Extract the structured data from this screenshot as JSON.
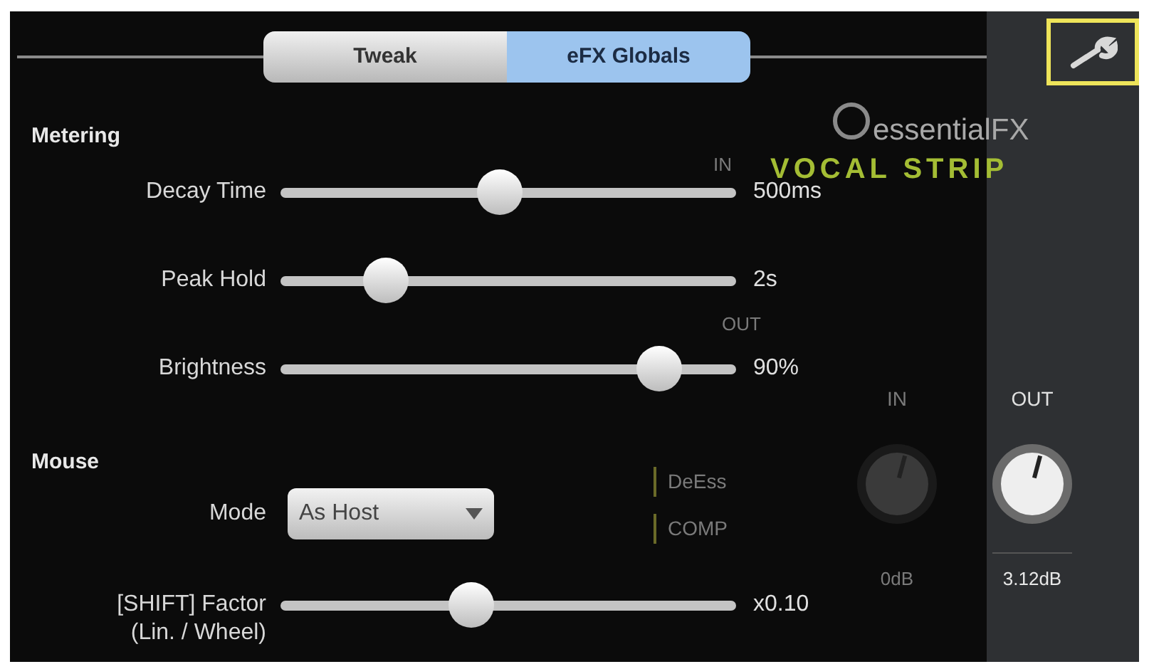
{
  "tabs": [
    {
      "label": "Tweak",
      "selected": false
    },
    {
      "label": "eFX Globals",
      "selected": true
    }
  ],
  "sections": [
    {
      "heading": "Metering",
      "rows": [
        {
          "kind": "slider",
          "label": "Decay Time",
          "level": 0.48,
          "reading": "500ms"
        },
        {
          "kind": "slider",
          "label": "Peak Hold",
          "level": 0.23,
          "reading": "2s"
        },
        {
          "kind": "slider",
          "label": "Brightness",
          "level": 0.83,
          "reading": "90%"
        }
      ]
    },
    {
      "heading": "Mouse",
      "rows": [
        {
          "kind": "dropdown",
          "label": "Mode",
          "value": "As Host"
        },
        {
          "kind": "slider",
          "label": "[SHIFT] Factor\n(Lin. / Wheel)",
          "level": 0.42,
          "reading": "x0.10"
        }
      ]
    }
  ],
  "background": {
    "brand": "essentialFX",
    "product": "VOCAL STRIP",
    "meter_labels": [
      "IN",
      "OUT"
    ],
    "modules": [
      "DeEss",
      "COMP"
    ],
    "knobs": [
      {
        "label": "IN",
        "reading": "0dB"
      },
      {
        "label": "OUT",
        "reading": "3.12dB"
      }
    ]
  }
}
